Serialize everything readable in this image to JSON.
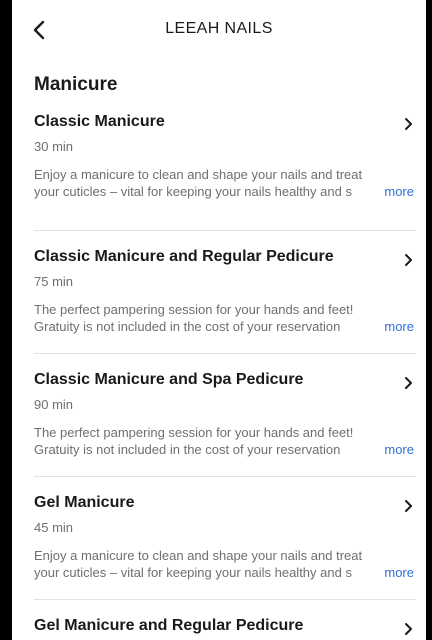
{
  "header": {
    "title": "LEEAH NAILS",
    "back_icon": "chevron-left-icon"
  },
  "section": {
    "title": "Manicure"
  },
  "services": [
    {
      "name": "Classic Manicure",
      "duration": "30 min",
      "description": "Enjoy a manicure to clean and shape your nails and treat your cuticles – vital for keeping your nails healthy and s",
      "more": "more"
    },
    {
      "name": "Classic Manicure and Regular Pedicure",
      "duration": "75 min",
      "description": "The perfect pampering session for your hands and feet! Gratuity is not included in the cost of your reservation",
      "more": "more"
    },
    {
      "name": "Classic Manicure and Spa Pedicure",
      "duration": "90 min",
      "description": "The perfect pampering session for your hands and feet! Gratuity is not included in the cost of your reservation",
      "more": "more"
    },
    {
      "name": "Gel Manicure",
      "duration": "45 min",
      "description": "Enjoy a manicure to clean and shape your nails and treat your cuticles – vital for keeping your nails healthy and s",
      "more": "more"
    },
    {
      "name": "Gel Manicure and Regular Pedicure"
    }
  ],
  "colors": {
    "link": "#2f6fd8",
    "text": "#1a1a1a",
    "muted": "#6f6f6f",
    "divider": "#e2e2e2"
  }
}
